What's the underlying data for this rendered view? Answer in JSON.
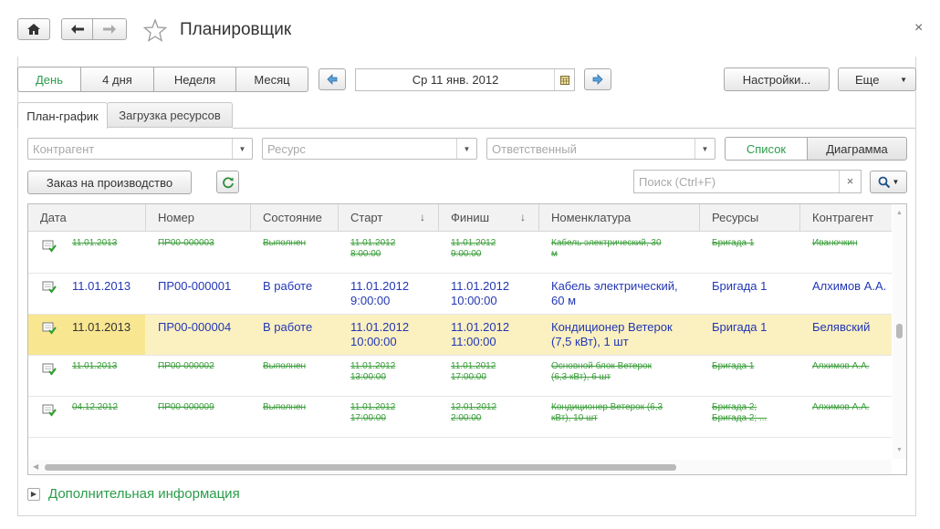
{
  "window": {
    "title": "Планировщик",
    "close_glyph": "×"
  },
  "nav": {
    "home_icon": "home-icon",
    "back_icon": "back-arrow-icon",
    "forward_icon": "forward-arrow-icon",
    "favorite_icon": "star-icon"
  },
  "period": {
    "tabs": [
      {
        "label": "День",
        "active": true
      },
      {
        "label": "4 дня",
        "active": false
      },
      {
        "label": "Неделя",
        "active": false
      },
      {
        "label": "Месяц",
        "active": false
      }
    ],
    "date": "Ср 11 янв. 2012"
  },
  "toolbar": {
    "settings_label": "Настройки...",
    "more_label": "Еще"
  },
  "tabs": [
    {
      "label": "План-график",
      "active": true
    },
    {
      "label": "Загрузка ресурсов",
      "active": false
    }
  ],
  "filters": {
    "counterparty_placeholder": "Контрагент",
    "resource_placeholder": "Ресурс",
    "responsible_placeholder": "Ответственный",
    "view_list_label": "Список",
    "view_diagram_label": "Диаграмма"
  },
  "actions": {
    "create_order_label": "Заказ на производство",
    "search_placeholder": "Поиск (Ctrl+F)",
    "clear_glyph": "×"
  },
  "table": {
    "columns": [
      "Дата",
      "Номер",
      "Состояние",
      "Старт",
      "Финиш",
      "Номенклатура",
      "Ресурсы",
      "Контрагент"
    ],
    "sort_glyph": "↓",
    "rows": [
      {
        "status": "done",
        "cells": [
          "11.01.2013",
          "ПР00-000003",
          "Выполнен",
          "11.01.2012\n8:00:00",
          "11.01.2012\n9:00:00",
          "Кабель электрический, 30\nм",
          "Бригада 1",
          "Иваночкин"
        ]
      },
      {
        "status": "work",
        "cells": [
          "11.01.2013",
          "ПР00-000001",
          "В работе",
          "11.01.2012\n9:00:00",
          "11.01.2012\n10:00:00",
          "Кабель электрический,\n60 м",
          "Бригада 1",
          "Алхимов А.А."
        ]
      },
      {
        "status": "work",
        "selected": true,
        "cells": [
          "11.01.2013",
          "ПР00-000004",
          "В работе",
          "11.01.2012\n10:00:00",
          "11.01.2012\n11:00:00",
          "Кондиционер Ветерок\n(7,5 кВт), 1 шт",
          "Бригада 1",
          "Белявский"
        ]
      },
      {
        "status": "done",
        "cells": [
          "11.01.2013",
          "ПР00-000002",
          "Выполнен",
          "11.01.2012\n13:00:00",
          "11.01.2012\n17:00:00",
          "Основной блок Ветерок\n(6,3 кВт), 6 шт",
          "Бригада 1",
          "Алхимов А.А."
        ]
      },
      {
        "status": "done",
        "cells": [
          "04.12.2012",
          "ПР00-000009",
          "Выполнен",
          "11.01.2012\n17:00:00",
          "12.01.2012\n2:00:00",
          "Кондиционер Ветерок (6,3\nкВт), 10 шт",
          "Бригада 2;\nБригада 2; ...",
          "Алхимов А.А."
        ]
      }
    ]
  },
  "footer": {
    "more_info_label": "Дополнительная информация"
  }
}
